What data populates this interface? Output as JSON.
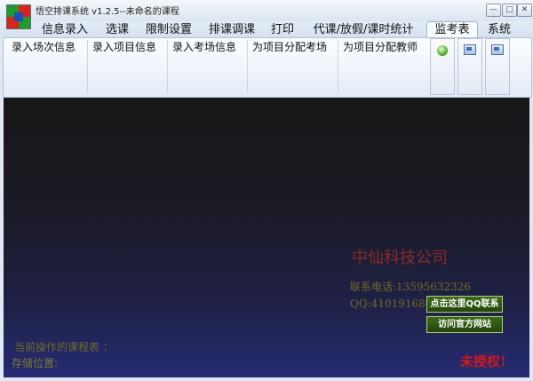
{
  "window": {
    "title": "悟空排课系统 v1.2.5--未命名的课程",
    "controls": {
      "minimize": "—",
      "maximize": "□",
      "close": "✕"
    }
  },
  "tabs": [
    {
      "label": "信息录入"
    },
    {
      "label": "选课"
    },
    {
      "label": "限制设置"
    },
    {
      "label": "排课调课"
    },
    {
      "label": "打印"
    },
    {
      "label": "代课/放假/课时统计"
    },
    {
      "label": "监考表",
      "active": true
    },
    {
      "label": "系统"
    }
  ],
  "ribbon": {
    "buttons": [
      {
        "label": "录入场次信息"
      },
      {
        "label": "录入项目信息"
      },
      {
        "label": "录入考场信息"
      },
      {
        "label": "为项目分配考场"
      },
      {
        "label": "为项目分配教师"
      }
    ],
    "icon_buttons": [
      "green-circle-icon",
      "window-icon",
      "window-icon"
    ]
  },
  "main": {
    "company": "中仙科技公司",
    "phone": "联系电话:13595632326",
    "qq": "QQ:410191680",
    "qq_button": "点击这里QQ联系",
    "website_button": "访问官方网站",
    "current_label": "当前操作的课程表 ：",
    "storage_label": "存储位置:",
    "unauthorized": "未授权!"
  },
  "colors": {
    "accent_red": "#d21a1a",
    "company_red": "#8b2a2a",
    "green_button": "#2e5a14",
    "olive_text": "#6f6a28"
  }
}
